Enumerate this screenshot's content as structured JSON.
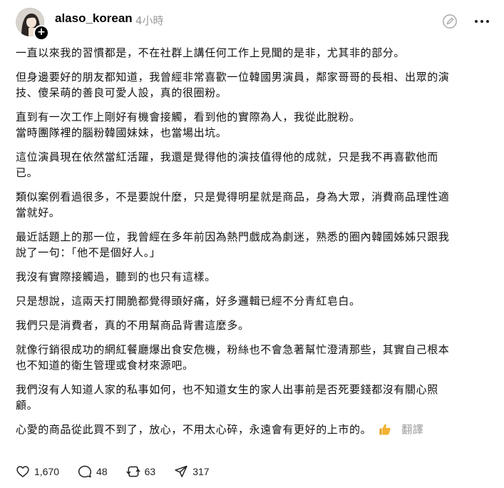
{
  "header": {
    "username": "alaso_korean",
    "timestamp": "4小時",
    "follow_badge": "+"
  },
  "post": {
    "paragraphs": [
      [
        "一直以來我的習慣都是，不在社群上講任何工作上見聞的是非，尤其非的部分。"
      ],
      [
        "但身邊要好的朋友都知道，我曾經非常喜歡一位韓國男演員，鄰家哥哥的長相、出眾的演",
        "技、傻呆萌的善良可愛人設，真的很圈粉。"
      ],
      [
        "直到有一次工作上剛好有機會接觸，看到他的實際為人，我從此脫粉。",
        "當時團隊裡的腦粉韓國妹妹，也當場出坑。"
      ],
      [
        "這位演員現在依然當紅活躍，我還是覺得他的演技值得他的成就，只是我不再喜歡他而",
        "已。"
      ],
      [
        "類似案例看過很多，不是要說什麼，只是覺得明星就是商品，身為大眾，消費商品理性適",
        "當就好。"
      ],
      [
        "最近話題上的那一位，我曾經在多年前因為熱門戲成為劇迷，熟悉的圈內韓國姊姊只跟我",
        "說了一句：「他不是個好人。」"
      ],
      [
        "我沒有實際接觸過，聽到的也只有這樣。"
      ],
      [
        "只是想說，這兩天打開脆都覺得頭好痛，好多邏輯已經不分青紅皂白。"
      ],
      [
        "我們只是消費者，真的不用幫商品背書這麼多。"
      ],
      [
        "就像行銷很成功的網紅餐廳爆出食安危機，粉絲也不會急著幫忙澄清那些，其實自己根本",
        "也不知道的衛生管理或食材來源吧。"
      ],
      [
        "我們沒有人知道人家的私事如何，也不知道女生的家人出事前是否死要錢都沒有關心照",
        "顧。"
      ]
    ],
    "last_line": "心愛的商品從此買不到了，放心，不用太心碎，永遠會有更好的上市的。",
    "translate_label": "翻譯"
  },
  "actions": {
    "likes": "1,670",
    "comments": "48",
    "reposts": "63",
    "shares": "317"
  },
  "icons": {
    "avatar": "avatar-photo",
    "edit": "edit-pencil-icon",
    "more": "more-dots-icon",
    "emoji": "thumbs-up-icon",
    "like": "heart-icon",
    "comment": "comment-bubble-icon",
    "repost": "repost-icon",
    "share": "share-send-icon"
  },
  "colors": {
    "text": "#111111",
    "muted": "#999999",
    "thumb": "#f2b233"
  }
}
